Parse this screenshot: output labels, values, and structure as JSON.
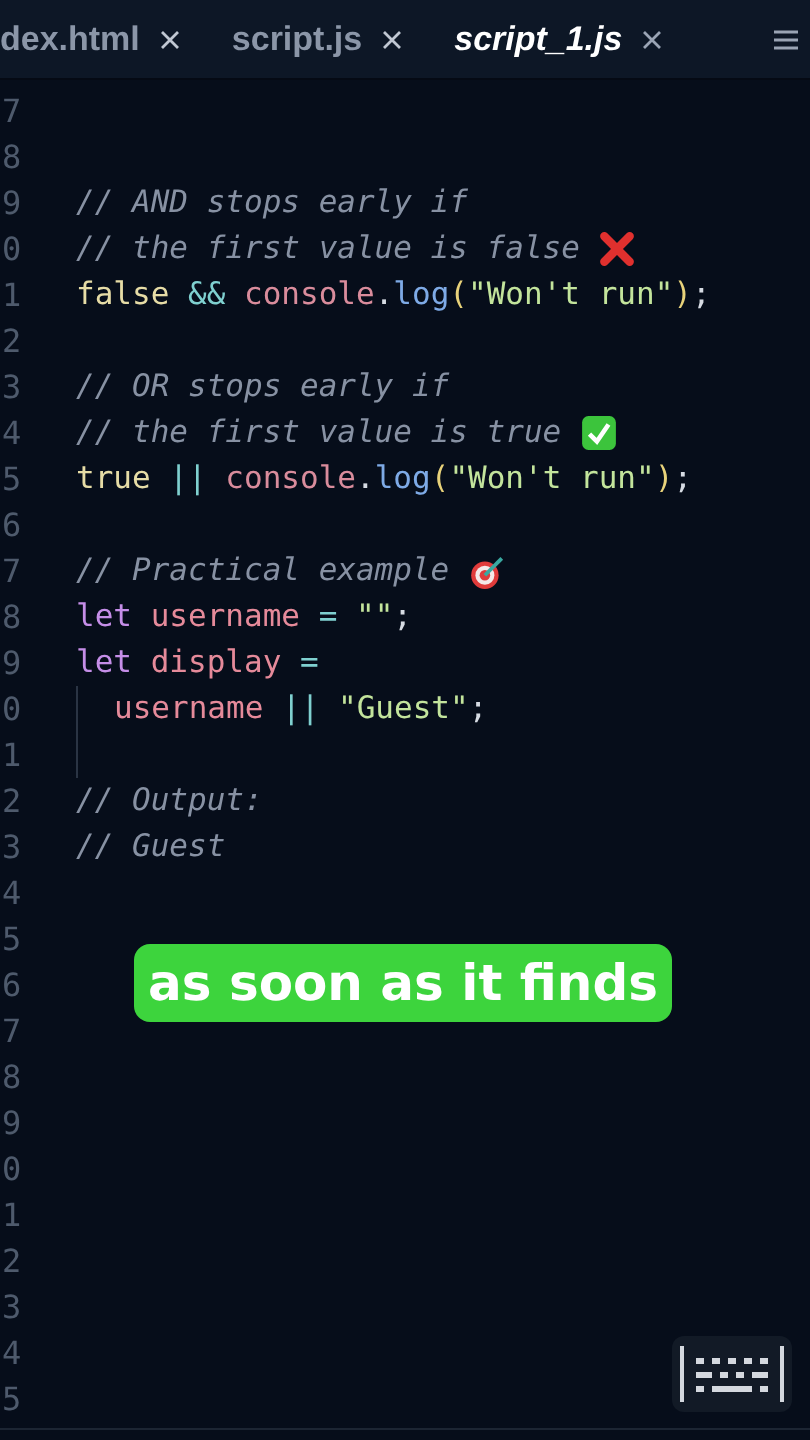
{
  "tabs": [
    {
      "label": "dex.html",
      "selected": false
    },
    {
      "label": "script.js",
      "selected": false
    },
    {
      "label": "script_1.js",
      "selected": true
    }
  ],
  "lines": [
    {
      "number": "7"
    },
    {
      "number": "8"
    },
    {
      "number": "9",
      "tokens": [
        {
          "kind": "comment",
          "text": "// AND stops early if"
        }
      ]
    },
    {
      "number": "0",
      "tokens": [
        {
          "kind": "comment",
          "text": "// the first value is false "
        },
        {
          "kind": "cross-emoji"
        }
      ]
    },
    {
      "number": "1",
      "tokens": [
        {
          "kind": "literal",
          "text": "false "
        },
        {
          "kind": "operator",
          "text": "&& "
        },
        {
          "kind": "object",
          "text": "console"
        },
        {
          "kind": "plain",
          "text": "."
        },
        {
          "kind": "function",
          "text": "log"
        },
        {
          "kind": "paren",
          "text": "("
        },
        {
          "kind": "string",
          "text": "\"Won't run\""
        },
        {
          "kind": "paren",
          "text": ")"
        },
        {
          "kind": "plain",
          "text": ";"
        }
      ]
    },
    {
      "number": "2"
    },
    {
      "number": "3",
      "tokens": [
        {
          "kind": "comment",
          "text": "// OR stops early if"
        }
      ]
    },
    {
      "number": "4",
      "tokens": [
        {
          "kind": "comment",
          "text": "// the first value is true "
        },
        {
          "kind": "check-emoji"
        }
      ]
    },
    {
      "number": "5",
      "tokens": [
        {
          "kind": "literal",
          "text": "true "
        },
        {
          "kind": "operator",
          "text": "|| "
        },
        {
          "kind": "object",
          "text": "console"
        },
        {
          "kind": "plain",
          "text": "."
        },
        {
          "kind": "function",
          "text": "log"
        },
        {
          "kind": "paren",
          "text": "("
        },
        {
          "kind": "string",
          "text": "\"Won't run\""
        },
        {
          "kind": "paren",
          "text": ")"
        },
        {
          "kind": "plain",
          "text": ";"
        }
      ]
    },
    {
      "number": "6"
    },
    {
      "number": "7",
      "tokens": [
        {
          "kind": "comment",
          "text": "// Practical example "
        },
        {
          "kind": "target-emoji"
        }
      ]
    },
    {
      "number": "8",
      "tokens": [
        {
          "kind": "keyword",
          "text": "let "
        },
        {
          "kind": "variable",
          "text": "username "
        },
        {
          "kind": "operator",
          "text": "= "
        },
        {
          "kind": "string",
          "text": "\"\""
        },
        {
          "kind": "plain",
          "text": ";"
        }
      ]
    },
    {
      "number": "9",
      "tokens": [
        {
          "kind": "keyword",
          "text": "let "
        },
        {
          "kind": "variable",
          "text": "display "
        },
        {
          "kind": "operator",
          "text": "="
        }
      ]
    },
    {
      "number": "0",
      "indented": true,
      "tokens": [
        {
          "kind": "variable",
          "text": "username "
        },
        {
          "kind": "operator",
          "text": "|| "
        },
        {
          "kind": "string",
          "text": "\"Guest\""
        },
        {
          "kind": "plain",
          "text": ";"
        }
      ]
    },
    {
      "number": "1",
      "indented": true
    },
    {
      "number": "2",
      "tokens": [
        {
          "kind": "comment",
          "text": "// Output:"
        }
      ]
    },
    {
      "number": "3",
      "tokens": [
        {
          "kind": "comment",
          "text": "// Guest"
        }
      ]
    },
    {
      "number": "4"
    },
    {
      "number": "5"
    },
    {
      "number": "6"
    },
    {
      "number": "7"
    },
    {
      "number": "8"
    },
    {
      "number": "9"
    },
    {
      "number": "0"
    },
    {
      "number": "1"
    },
    {
      "number": "2"
    },
    {
      "number": "3"
    },
    {
      "number": "4"
    },
    {
      "number": "5"
    }
  ],
  "caption": "as soon as it finds"
}
